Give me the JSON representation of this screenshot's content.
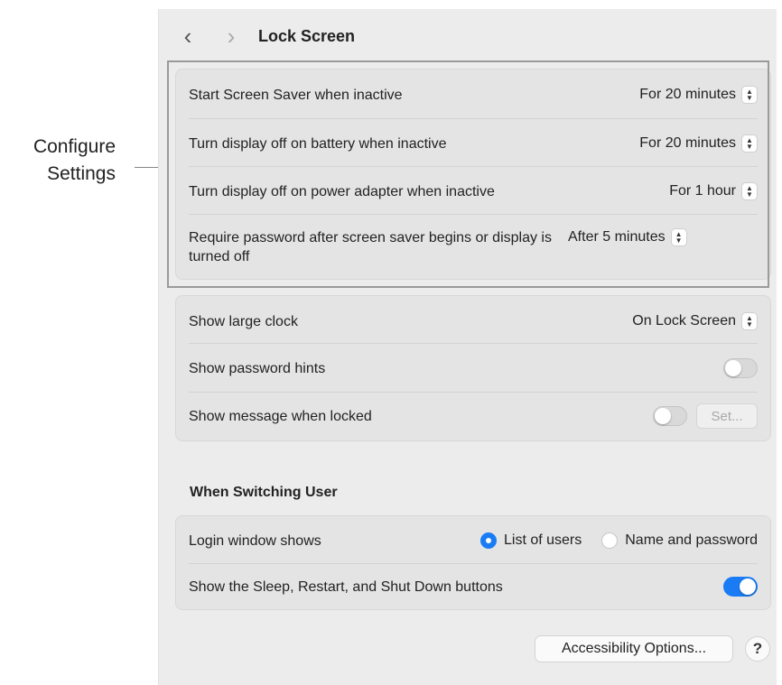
{
  "callout": {
    "line1": "Configure",
    "line2": "Settings"
  },
  "toolbar": {
    "back_icon": "‹",
    "forward_icon": "›",
    "title": "Lock Screen"
  },
  "settings_group": {
    "rows": [
      {
        "label": "Start Screen Saver when inactive",
        "value": "For 20 minutes"
      },
      {
        "label": "Turn display off on battery when inactive",
        "value": "For 20 minutes"
      },
      {
        "label": "Turn display off on power adapter when inactive",
        "value": "For 1 hour"
      },
      {
        "label": "Require password after screen saver begins or display is turned off",
        "value": "After 5 minutes"
      }
    ]
  },
  "display_group": {
    "large_clock": {
      "label": "Show large clock",
      "value": "On Lock Screen"
    },
    "password_hints": {
      "label": "Show password hints",
      "enabled": false
    },
    "message_locked": {
      "label": "Show message when locked",
      "enabled": false,
      "set_label": "Set..."
    }
  },
  "switching": {
    "title": "When Switching User",
    "login_window": {
      "label": "Login window shows",
      "options": [
        "List of users",
        "Name and password"
      ],
      "selected": "List of users"
    },
    "sleep_buttons": {
      "label": "Show the Sleep, Restart, and Shut Down buttons",
      "enabled": true
    }
  },
  "footer": {
    "accessibility_label": "Accessibility Options...",
    "help_label": "?"
  },
  "colors": {
    "accent": "#1a7cf5",
    "window_bg": "#ececec",
    "group_bg": "#e4e4e4"
  }
}
